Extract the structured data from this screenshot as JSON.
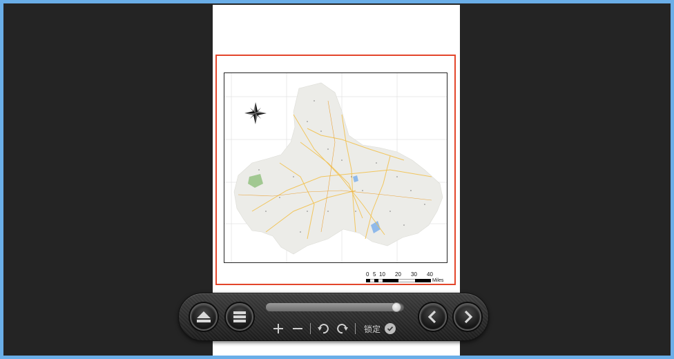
{
  "viewer": {
    "scale_bar": {
      "numbers": [
        "0",
        "5",
        "10",
        "20",
        "30",
        "40"
      ],
      "unit": "Miles"
    },
    "progress_percent": 98,
    "lock_label": "锁定",
    "buttons": {
      "eject": "eject-icon",
      "menu": "menu-icon",
      "zoom_in": "plus-icon",
      "zoom_out": "minus-icon",
      "rotate_left": "rotate-left-icon",
      "rotate_right": "rotate-right-icon",
      "lock": "check-circle-icon",
      "prev": "chevron-left-icon",
      "next": "chevron-right-icon"
    },
    "colors": {
      "outer_border": "#6aaee8",
      "background": "#242424",
      "selection_border": "#e3452a",
      "map_land": "#ecece8",
      "road": "#f2c14e",
      "water": "#8fb9ea",
      "park": "#8fbf7a"
    }
  }
}
